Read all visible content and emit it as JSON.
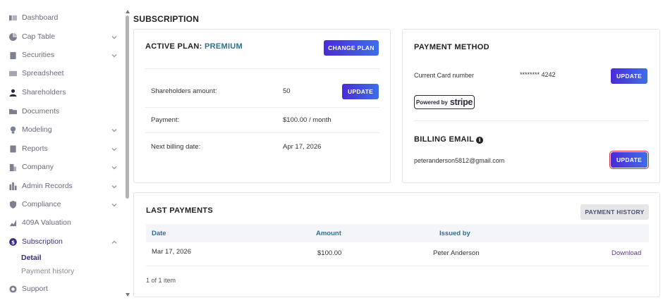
{
  "sidebar": {
    "items": [
      {
        "label": "Dashboard",
        "icon": "dashboard-icon",
        "chevron": false
      },
      {
        "label": "Cap Table",
        "icon": "pie-chart-icon",
        "chevron": true
      },
      {
        "label": "Securities",
        "icon": "clipboard-icon",
        "chevron": true
      },
      {
        "label": "Spreadsheet",
        "icon": "table-icon",
        "chevron": false
      },
      {
        "label": "Shareholders",
        "icon": "person-icon",
        "chevron": false
      },
      {
        "label": "Documents",
        "icon": "folder-icon",
        "chevron": false
      },
      {
        "label": "Modeling",
        "icon": "bulb-icon",
        "chevron": true
      },
      {
        "label": "Reports",
        "icon": "report-icon",
        "chevron": true
      },
      {
        "label": "Company",
        "icon": "building-icon",
        "chevron": true
      },
      {
        "label": "Admin Records",
        "icon": "records-icon",
        "chevron": true
      },
      {
        "label": "Compliance",
        "icon": "shield-icon",
        "chevron": true
      },
      {
        "label": "409A Valuation",
        "icon": "valuation-icon",
        "chevron": false
      },
      {
        "label": "Subscription",
        "icon": "dollar-icon",
        "chevron": true
      },
      {
        "label": "Support",
        "icon": "support-icon",
        "chevron": false
      }
    ],
    "sub_items": [
      {
        "label": "Detail"
      },
      {
        "label": "Payment history"
      }
    ]
  },
  "page": {
    "title": "SUBSCRIPTION"
  },
  "plan": {
    "heading": "ACTIVE PLAN:",
    "plan_name": "PREMIUM",
    "change_label": "CHANGE PLAN",
    "shareholders_label": "Shareholders amount:",
    "shareholders_value": "50",
    "update_label": "UPDATE",
    "payment_label": "Payment:",
    "payment_value": "$100.00 / month",
    "next_billing_label": "Next billing date:",
    "next_billing_value": "Apr 17, 2026"
  },
  "payment_method": {
    "heading": "PAYMENT METHOD",
    "card_label": "Current Card number",
    "card_value": "******** 4242",
    "update_label": "UPDATE",
    "powered_by": "Powered by",
    "stripe": "stripe",
    "billing_heading": "BILLING EMAIL",
    "billing_email": "peteranderson5812@gmail.com",
    "billing_update_label": "UPDATE"
  },
  "last_payments": {
    "heading": "LAST PAYMENTS",
    "history_label": "PAYMENT HISTORY",
    "columns": {
      "date": "Date",
      "amount": "Amount",
      "issued_by": "Issued by"
    },
    "rows": [
      {
        "date": "Mar 17, 2026",
        "amount": "$100.00",
        "issued_by": "Peter Anderson",
        "action": "Download"
      }
    ],
    "pagination": "1 of 1 item"
  },
  "colors": {
    "accent": "#2e6f8f",
    "button_start": "#4a2bd6",
    "button_end": "#3e6fe6",
    "active_nav": "#3d2a7a",
    "focus_outline": "#e0262b"
  }
}
